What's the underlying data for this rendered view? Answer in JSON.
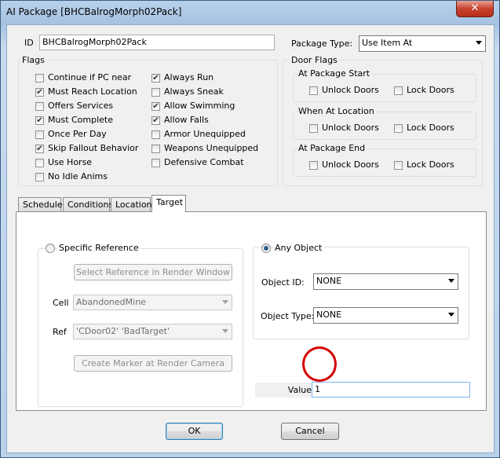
{
  "window": {
    "title": "AI Package [BHCBalrogMorph02Pack]",
    "close_glyph": "✕"
  },
  "id_field": {
    "label": "ID",
    "value": "BHCBalrogMorph02Pack"
  },
  "package_type": {
    "label": "Package Type:",
    "value": "Use Item At"
  },
  "flags": {
    "legend": "Flags",
    "col1": [
      {
        "label": "Continue if PC near",
        "checked": false
      },
      {
        "label": "Must Reach Location",
        "checked": true
      },
      {
        "label": "Offers Services",
        "checked": false
      },
      {
        "label": "Must Complete",
        "checked": true
      },
      {
        "label": "Once Per Day",
        "checked": false
      },
      {
        "label": "Skip Fallout Behavior",
        "checked": true
      },
      {
        "label": "Use Horse",
        "checked": false
      },
      {
        "label": "No Idle Anims",
        "checked": false
      }
    ],
    "col2": [
      {
        "label": "Always Run",
        "checked": true
      },
      {
        "label": "Always Sneak",
        "checked": false
      },
      {
        "label": "Allow Swimming",
        "checked": true
      },
      {
        "label": "Allow Falls",
        "checked": true
      },
      {
        "label": "Armor Unequipped",
        "checked": false
      },
      {
        "label": "Weapons Unequipped",
        "checked": false
      },
      {
        "label": "Defensive Combat",
        "checked": false
      }
    ]
  },
  "door_flags": {
    "legend": "Door Flags",
    "groups": [
      {
        "legend": "At Package Start",
        "unlock": "Unlock Doors",
        "lock": "Lock Doors"
      },
      {
        "legend": "When At Location",
        "unlock": "Unlock Doors",
        "lock": "Lock Doors"
      },
      {
        "legend": "At Package End",
        "unlock": "Unlock Doors",
        "lock": "Lock Doors"
      }
    ]
  },
  "tabs": [
    "Schedule",
    "Conditions",
    "Location",
    "Target"
  ],
  "target": {
    "specific_reference": {
      "label": "Specific Reference",
      "select_button": "Select Reference in Render Window",
      "cell_label": "Cell",
      "cell_value": "AbandonedMine",
      "ref_label": "Ref",
      "ref_value": "'CDoor02' 'BadTarget'",
      "marker_button": "Create Marker at Render Camera"
    },
    "any_object": {
      "label": "Any Object",
      "object_id_label": "Object ID:",
      "object_id_value": "NONE",
      "object_type_label": "Object Type:",
      "object_type_value": "NONE"
    },
    "value_label": "Value",
    "value": "1"
  },
  "buttons": {
    "ok": "OK",
    "cancel": "Cancel"
  },
  "check_glyph": "✔",
  "colors": {
    "annotation_circle": "#d40000"
  }
}
